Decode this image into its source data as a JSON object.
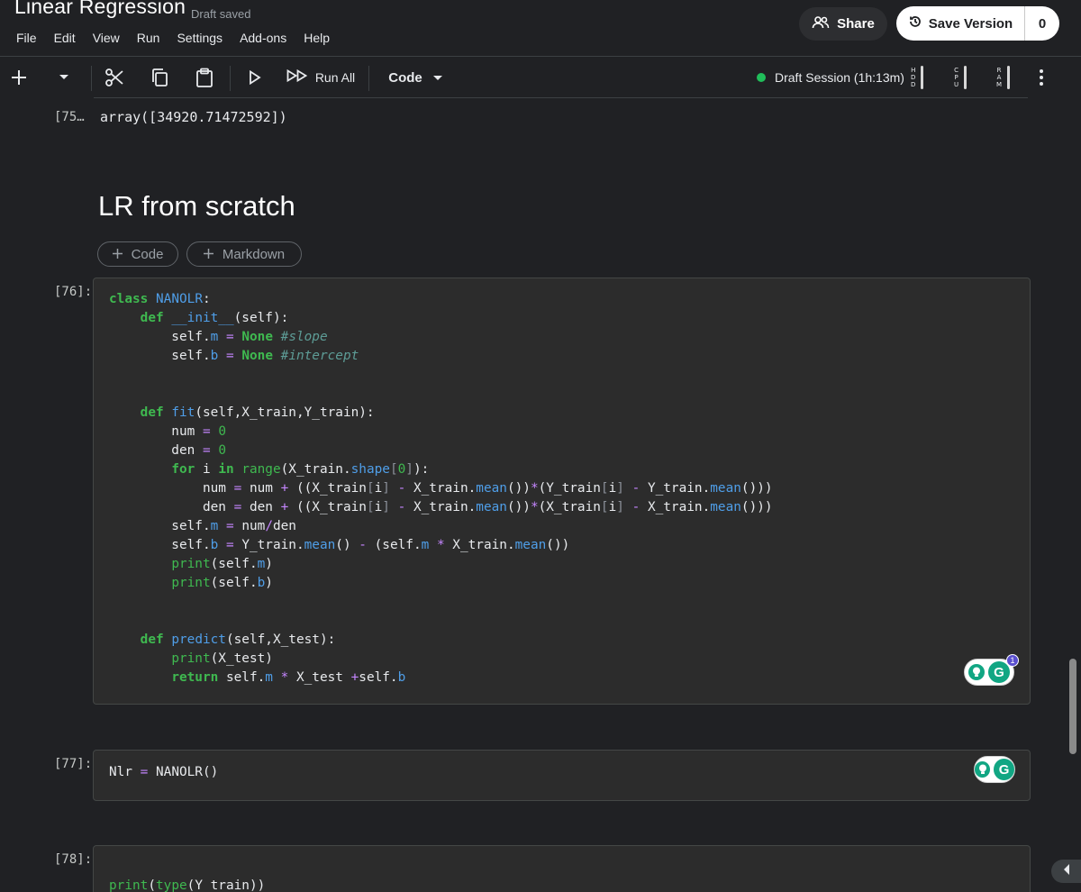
{
  "header": {
    "title": "Linear Regression",
    "status": "Draft saved",
    "share_label": "Share",
    "save_version_label": "Save Version",
    "version_count": "0"
  },
  "menu": [
    "File",
    "Edit",
    "View",
    "Run",
    "Settings",
    "Add-ons",
    "Help"
  ],
  "toolbar": {
    "run_all_label": "Run All",
    "cell_type": "Code",
    "session_label": "Draft Session (1h:13m)",
    "session_color": "#20be5a",
    "meters": [
      {
        "letters": [
          "H",
          "D",
          "D"
        ],
        "name": "hdd"
      },
      {
        "letters": [
          "C",
          "P",
          "U"
        ],
        "name": "cpu"
      },
      {
        "letters": [
          "R",
          "A",
          "M"
        ],
        "name": "ram"
      }
    ]
  },
  "cells": {
    "c75": {
      "prompt": "[75…",
      "output": "array([34920.71472592])"
    },
    "markdown_heading": "LR from scratch",
    "add_code_label": "Code",
    "add_markdown_label": "Markdown",
    "c76": {
      "prompt": "[76]:"
    },
    "c77": {
      "prompt": "[77]:"
    },
    "c78": {
      "prompt": "[78]:"
    }
  },
  "grammarly": {
    "badge_count": "1"
  },
  "colors": {
    "background": "#202124",
    "cell_bg": "#2c2c2c",
    "keyword": "#3fb950",
    "function": "#4f9ee8",
    "operator": "#c586ff",
    "comment": "#5d9c96"
  }
}
